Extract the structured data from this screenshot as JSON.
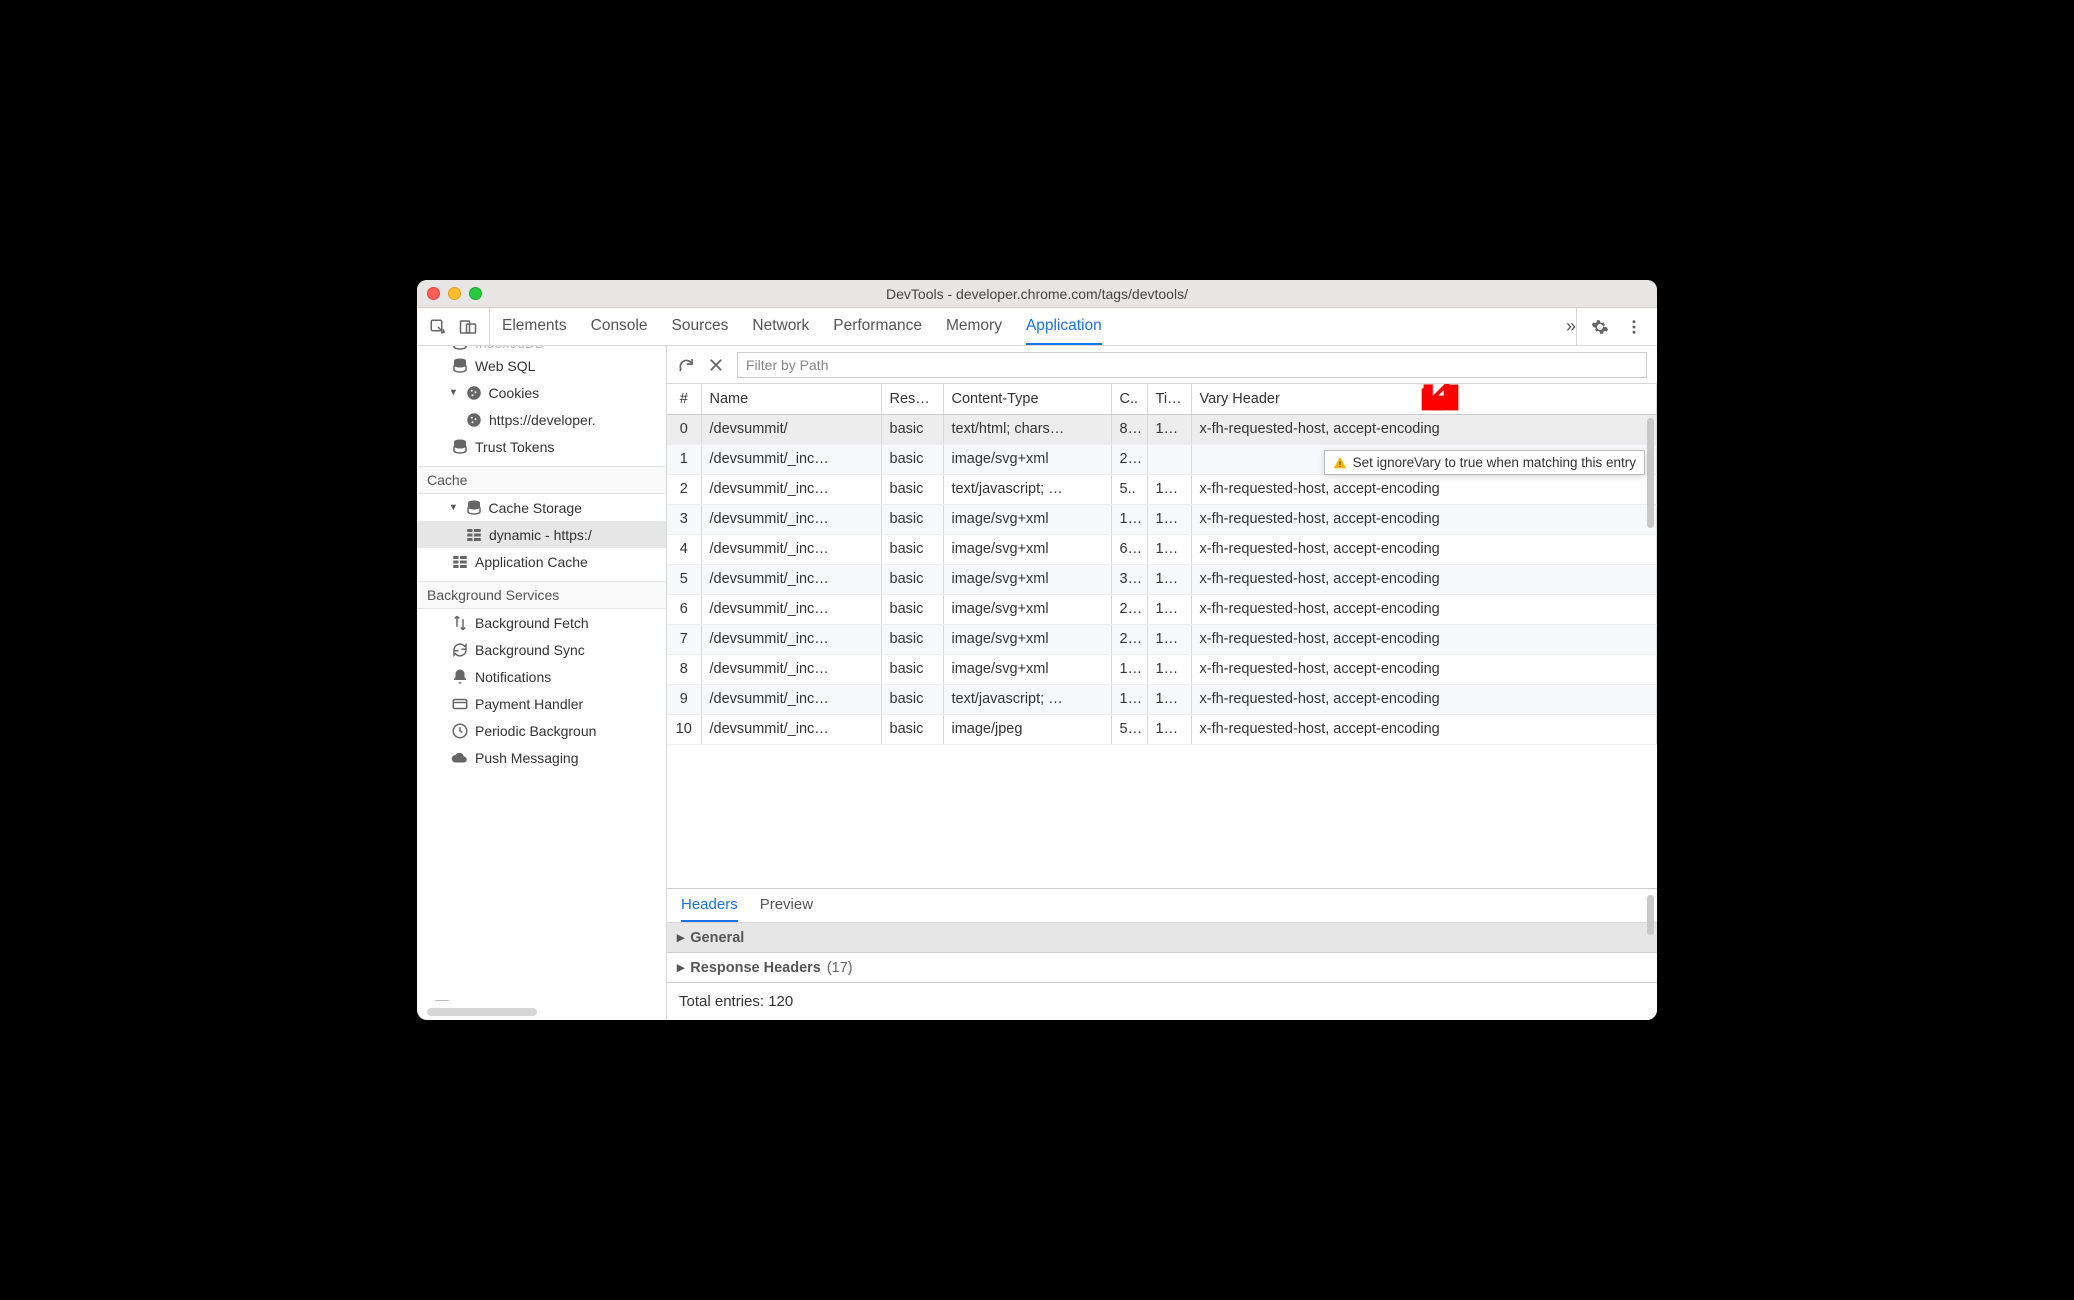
{
  "window_title": "DevTools - developer.chrome.com/tags/devtools/",
  "top_tabs": [
    "Elements",
    "Console",
    "Sources",
    "Network",
    "Performance",
    "Memory",
    "Application"
  ],
  "top_active_index": 6,
  "filter": {
    "placeholder": "Filter by Path"
  },
  "sidebar": {
    "items": [
      {
        "indent": "l1",
        "icon": "db",
        "label": "IndexedDB",
        "cutoff": true
      },
      {
        "indent": "l1",
        "icon": "db",
        "label": "Web SQL"
      },
      {
        "indent": "l1",
        "icon": "cookie",
        "label": "Cookies",
        "expandable": true
      },
      {
        "indent": "l3",
        "icon": "cookie",
        "label": "https://developer."
      },
      {
        "indent": "l1",
        "icon": "db",
        "label": "Trust Tokens"
      }
    ],
    "cache_section": "Cache",
    "cache_items": [
      {
        "indent": "l1",
        "icon": "db",
        "label": "Cache Storage",
        "expandable": true
      },
      {
        "indent": "l3",
        "icon": "grid",
        "label": "dynamic - https:/",
        "selected": true
      },
      {
        "indent": "l1",
        "icon": "grid",
        "label": "Application Cache"
      }
    ],
    "bg_section": "Background Services",
    "bg_items": [
      {
        "icon": "updown",
        "label": "Background Fetch"
      },
      {
        "icon": "sync",
        "label": "Background Sync"
      },
      {
        "icon": "bell",
        "label": "Notifications"
      },
      {
        "icon": "card",
        "label": "Payment Handler"
      },
      {
        "icon": "clock",
        "label": "Periodic Backgroun"
      },
      {
        "icon": "cloud",
        "label": "Push Messaging"
      }
    ]
  },
  "columns": [
    "#",
    "Name",
    "Res…",
    "Content-Type",
    "C..",
    "Ti…",
    "Vary Header"
  ],
  "rows": [
    {
      "n": "0",
      "name": "/devsummit/",
      "res": "basic",
      "ct": "text/html; chars…",
      "c": "8…",
      "t": "1…",
      "vary": "x-fh-requested-host, accept-encoding",
      "selected": true
    },
    {
      "n": "1",
      "name": "/devsummit/_inc…",
      "res": "basic",
      "ct": "image/svg+xml",
      "c": "2…",
      "t": "",
      "vary": ""
    },
    {
      "n": "2",
      "name": "/devsummit/_inc…",
      "res": "basic",
      "ct": "text/javascript; …",
      "c": "5..",
      "t": "1…",
      "vary": "x-fh-requested-host, accept-encoding"
    },
    {
      "n": "3",
      "name": "/devsummit/_inc…",
      "res": "basic",
      "ct": "image/svg+xml",
      "c": "1…",
      "t": "1…",
      "vary": "x-fh-requested-host, accept-encoding"
    },
    {
      "n": "4",
      "name": "/devsummit/_inc…",
      "res": "basic",
      "ct": "image/svg+xml",
      "c": "6…",
      "t": "1…",
      "vary": "x-fh-requested-host, accept-encoding"
    },
    {
      "n": "5",
      "name": "/devsummit/_inc…",
      "res": "basic",
      "ct": "image/svg+xml",
      "c": "3…",
      "t": "1…",
      "vary": "x-fh-requested-host, accept-encoding"
    },
    {
      "n": "6",
      "name": "/devsummit/_inc…",
      "res": "basic",
      "ct": "image/svg+xml",
      "c": "2…",
      "t": "1…",
      "vary": "x-fh-requested-host, accept-encoding"
    },
    {
      "n": "7",
      "name": "/devsummit/_inc…",
      "res": "basic",
      "ct": "image/svg+xml",
      "c": "2…",
      "t": "1…",
      "vary": "x-fh-requested-host, accept-encoding"
    },
    {
      "n": "8",
      "name": "/devsummit/_inc…",
      "res": "basic",
      "ct": "image/svg+xml",
      "c": "1…",
      "t": "1…",
      "vary": "x-fh-requested-host, accept-encoding"
    },
    {
      "n": "9",
      "name": "/devsummit/_inc…",
      "res": "basic",
      "ct": "text/javascript; …",
      "c": "1…",
      "t": "1…",
      "vary": "x-fh-requested-host, accept-encoding"
    },
    {
      "n": "10",
      "name": "/devsummit/_inc…",
      "res": "basic",
      "ct": "image/jpeg",
      "c": "5…",
      "t": "1…",
      "vary": "x-fh-requested-host, accept-encoding"
    }
  ],
  "tooltip_text": "Set ignoreVary to true when matching this entry",
  "details": {
    "tabs": [
      "Headers",
      "Preview"
    ],
    "active": 0,
    "sections": {
      "general": "General",
      "response": "Response Headers",
      "response_count": "(17)"
    },
    "total_label": "Total entries: 120"
  }
}
